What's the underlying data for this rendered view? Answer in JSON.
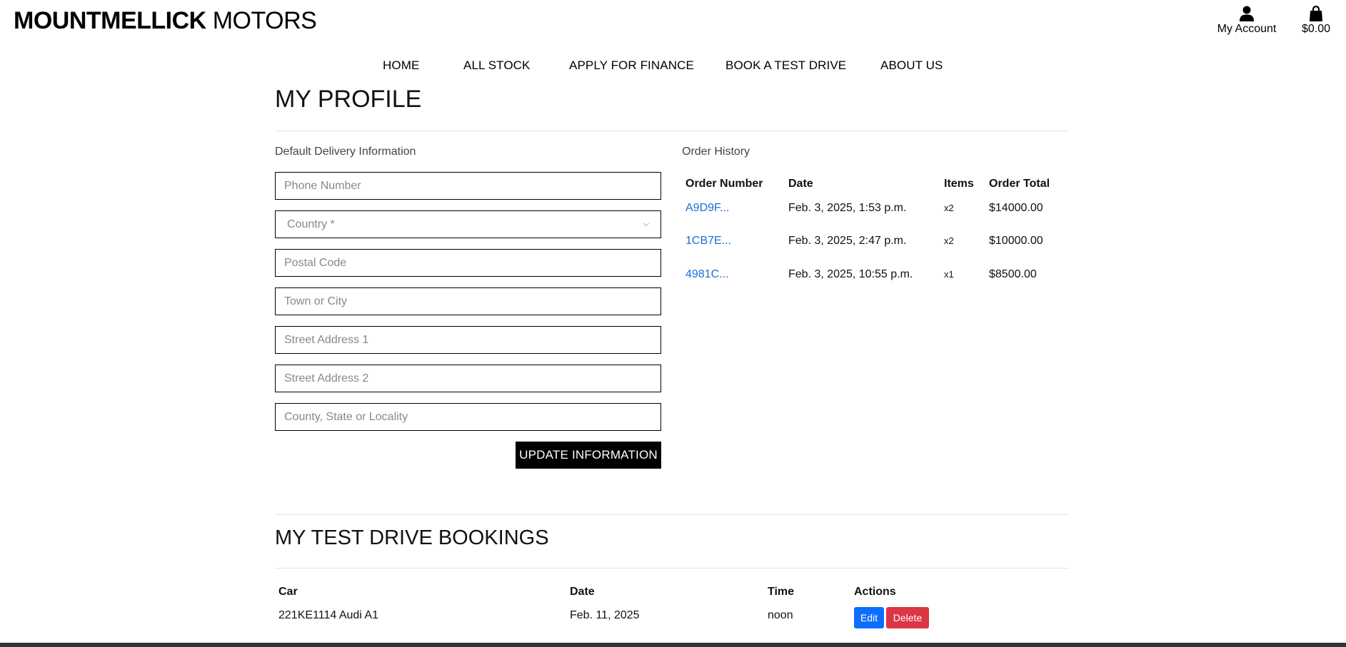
{
  "header": {
    "logo_bold": "MOUNTMELLICK",
    "logo_rest": " MOTORS",
    "account_label": "My Account",
    "bag_total": "$0.00",
    "account_icon": "user-icon",
    "bag_icon": "shopping-bag-icon"
  },
  "nav": {
    "items": [
      "HOME",
      "ALL STOCK",
      "APPLY FOR FINANCE",
      "BOOK A TEST DRIVE",
      "ABOUT US"
    ]
  },
  "profile": {
    "title": "MY PROFILE",
    "delivery_label": "Default Delivery Information",
    "fields": {
      "phone": "Phone Number",
      "country": "Country *",
      "postal": "Postal Code",
      "town": "Town or City",
      "street1": "Street Address 1",
      "street2": "Street Address 2",
      "county": "County, State or Locality"
    },
    "update_button": "UPDATE INFORMATION"
  },
  "orders": {
    "label": "Order History",
    "headers": [
      "Order Number",
      "Date",
      "Items",
      "Order Total"
    ],
    "rows": [
      {
        "number": "A9D9F...",
        "date": "Feb. 3, 2025, 1:53 p.m.",
        "items": "x2",
        "total": "$14000.00"
      },
      {
        "number": "1CB7E...",
        "date": "Feb. 3, 2025, 2:47 p.m.",
        "items": "x2",
        "total": "$10000.00"
      },
      {
        "number": "4981C...",
        "date": "Feb. 3, 2025, 10:55 p.m.",
        "items": "x1",
        "total": "$8500.00"
      }
    ]
  },
  "bookings": {
    "title": "MY TEST DRIVE BOOKINGS",
    "headers": [
      "Car",
      "Date",
      "Time",
      "Actions"
    ],
    "rows": [
      {
        "car": "221KE1114 Audi A1",
        "date": "Feb. 11, 2025",
        "time": "noon",
        "edit": "Edit",
        "delete": "Delete"
      }
    ]
  },
  "colors": {
    "link": "#1a6fd6",
    "edit_button": "#0d6efd",
    "delete_button": "#dc3545",
    "primary_button": "#000000"
  }
}
